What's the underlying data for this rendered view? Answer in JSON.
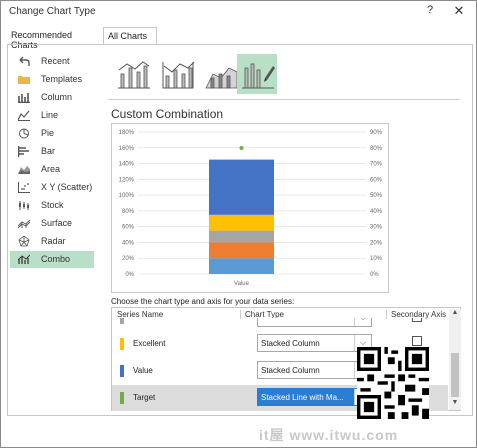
{
  "window": {
    "title": "Change Chart Type",
    "help_glyph": "?",
    "close_glyph": "✕"
  },
  "tabs": [
    {
      "label": "Recommended Charts"
    },
    {
      "label": "All Charts"
    }
  ],
  "chart_types": [
    {
      "label": "Recent",
      "icon": "undo-icon"
    },
    {
      "label": "Templates",
      "icon": "folder-icon"
    },
    {
      "label": "Column",
      "icon": "column-chart-icon"
    },
    {
      "label": "Line",
      "icon": "line-chart-icon"
    },
    {
      "label": "Pie",
      "icon": "pie-chart-icon"
    },
    {
      "label": "Bar",
      "icon": "bar-chart-icon"
    },
    {
      "label": "Area",
      "icon": "area-chart-icon"
    },
    {
      "label": "X Y (Scatter)",
      "icon": "scatter-chart-icon"
    },
    {
      "label": "Stock",
      "icon": "stock-chart-icon"
    },
    {
      "label": "Surface",
      "icon": "surface-chart-icon"
    },
    {
      "label": "Radar",
      "icon": "radar-chart-icon"
    },
    {
      "label": "Combo",
      "icon": "combo-chart-icon",
      "selected": true
    }
  ],
  "combo_section": {
    "title": "Custom Combination",
    "instruction": "Choose the chart type and axis for your data series:"
  },
  "chart_data": {
    "type": "bar",
    "categories": [
      "Value"
    ],
    "series": [
      {
        "values": [
          0.2
        ],
        "color": "#5b9bd5"
      },
      {
        "values": [
          0.2
        ],
        "color": "#ed7d31"
      },
      {
        "values": [
          0.15
        ],
        "color": "#a5a5a5"
      },
      {
        "values": [
          0.2
        ],
        "color": "#ffc000"
      },
      {
        "values": [
          0.7
        ],
        "color": "#4472c4"
      }
    ],
    "target_point": {
      "value": "",
      "color": "#70ad47"
    },
    "left_axis": {
      "labels": [
        "180%",
        "160%",
        "140%",
        "120%",
        "100%",
        "80%",
        "60%",
        "40%",
        "20%",
        "0%"
      ],
      "ylim": [
        0,
        1.8
      ]
    },
    "right_axis": {
      "labels": [
        "90%",
        "80%",
        "70%",
        "60%",
        "50%",
        "40%",
        "30%",
        "20%",
        "10%",
        "0%"
      ]
    },
    "grid": true
  },
  "series_table": {
    "headers": {
      "name": "Series Name",
      "type": "Chart Type",
      "axis": "Secondary Axis"
    },
    "rows": [
      {
        "name": "",
        "chart_type": "",
        "color": "#a5a5a5",
        "partial": true
      },
      {
        "name": "Excellent",
        "chart_type": "Stacked Column",
        "color": "#ffc000"
      },
      {
        "name": "Value",
        "chart_type": "Stacked Column",
        "color": "#4472c4"
      },
      {
        "name": "Target",
        "chart_type": "Stacked Line with Ma...",
        "color": "#70ad47",
        "selected": true
      }
    ],
    "dropdown_arrow": "⌵",
    "scroll_up": "▲",
    "scroll_down": "▼"
  },
  "watermark": "it屋 www.itwu.com"
}
